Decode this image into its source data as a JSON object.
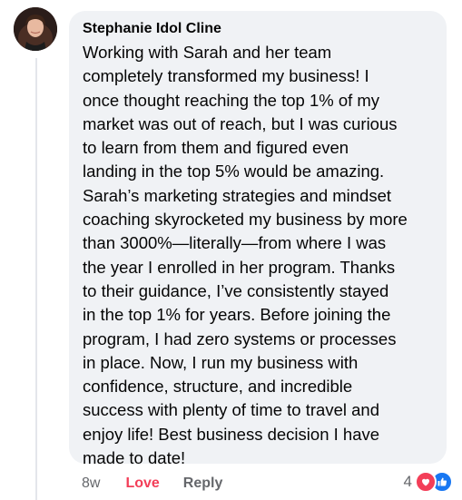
{
  "comment": {
    "author": "Stephanie Idol Cline",
    "lines": [
      "Working with Sarah and her team",
      "completely transformed my business! I",
      "once thought reaching the top 1% of my",
      "market was out of reach, but I was curious",
      "to learn from them and figured even",
      "landing in the top 5% would be amazing.",
      "Sarah’s marketing strategies and mindset",
      "coaching skyrocketed my business by more",
      "than 3000%—literally—from where I was",
      "the year I enrolled in her program. Thanks",
      "to their guidance, I’ve consistently stayed",
      "in the top 1% for years. Before joining the",
      "program, I had zero systems or processes",
      "in place. Now, I run my business with",
      "confidence, structure, and incredible",
      "success with plenty of time to travel and",
      "enjoy life! Best business decision I have",
      "made to date!"
    ]
  },
  "actions": {
    "time": "8w",
    "love_label": "Love",
    "reply_label": "Reply"
  },
  "reactions": {
    "count": "4",
    "icons": [
      "love-reaction-icon",
      "like-reaction-icon"
    ]
  },
  "colors": {
    "bubble": "#f0f2f5",
    "love": "#f33e58",
    "like": "#1877f2",
    "secondary_text": "#65676b"
  }
}
